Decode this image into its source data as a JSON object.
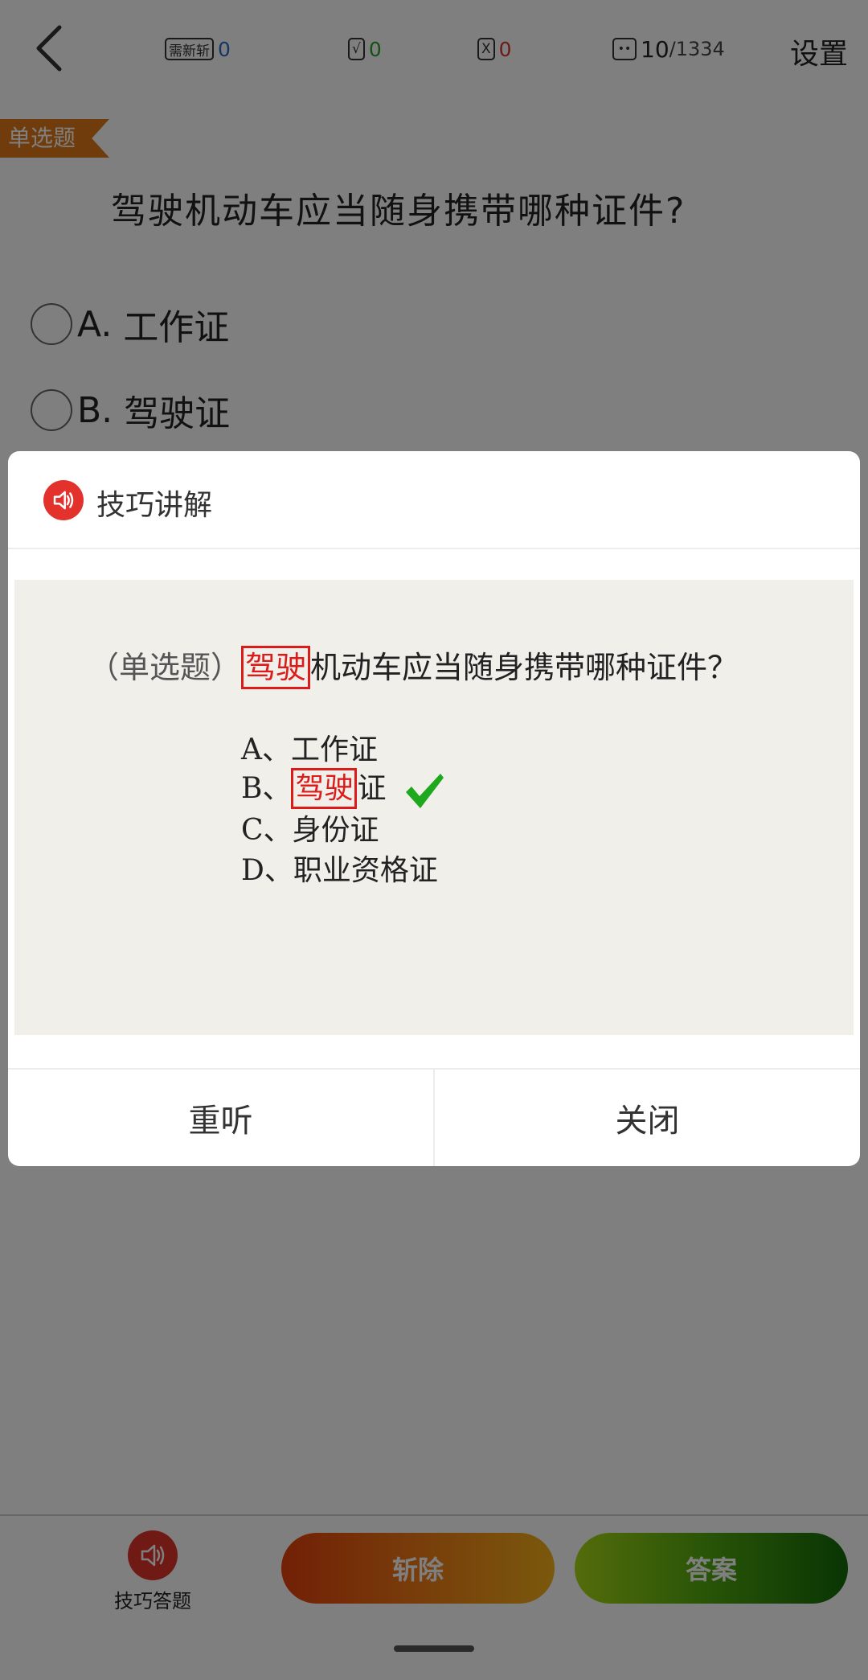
{
  "topbar": {
    "back_icon": "chevron-left-icon",
    "refresh_label": "需新斩",
    "refresh_count": "0",
    "correct_label": "√",
    "correct_count": "0",
    "wrong_label": "X",
    "wrong_count": "0",
    "progress_icon": "card-icon",
    "progress_current": "10",
    "progress_total": "/1334",
    "settings_label": "设置"
  },
  "question": {
    "type_tag": "单选题",
    "text": "驾驶机动车应当随身携带哪种证件?",
    "options": [
      {
        "letter": "A.",
        "text": "工作证"
      },
      {
        "letter": "B.",
        "text": "驾驶证"
      }
    ]
  },
  "dialog": {
    "title": "技巧讲解",
    "title_icon": "speaker-icon",
    "panel": {
      "question_type": "（单选题）",
      "question_highlight": "驾驶",
      "question_rest": "机动车应当随身携带哪种证件？",
      "options": [
        {
          "prefix": "A、",
          "highlight": "",
          "rest": "工作证"
        },
        {
          "prefix": "B、",
          "highlight": "驾驶",
          "rest": "证"
        },
        {
          "prefix": "C、",
          "highlight": "",
          "rest": "身份证"
        },
        {
          "prefix": "D、",
          "highlight": "",
          "rest": "职业资格证"
        }
      ],
      "correct_icon": "checkmark-icon"
    },
    "replay_label": "重听",
    "close_label": "关闭"
  },
  "bottombar": {
    "tip_answer_label": "技巧答题",
    "remove_label": "斩除",
    "answer_label": "答案"
  },
  "colors": {
    "accent_orange": "#e07818",
    "highlight_red": "#dc1b1b",
    "correct_green": "#2fa02f",
    "wrong_red": "#d9362b",
    "refresh_blue": "#2b6dc9"
  }
}
